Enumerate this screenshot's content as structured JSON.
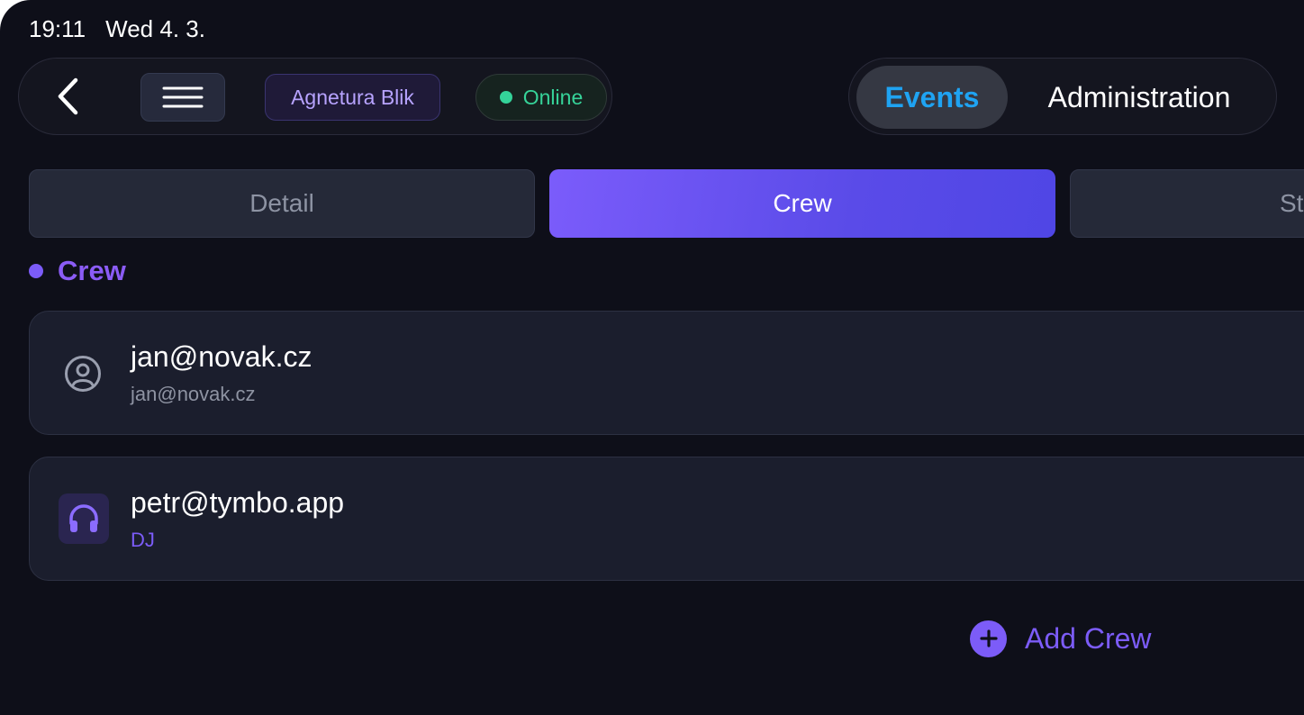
{
  "status_bar": {
    "time": "19:11",
    "date": "Wed 4. 3."
  },
  "toolbar": {
    "back_icon": "chevron-left-icon",
    "menu_icon": "hamburger-menu-icon",
    "agency": "Agnetura Blik",
    "status": "Online",
    "status_color": "#34d399"
  },
  "nav": {
    "events_label": "Events",
    "administration_label": "Administration",
    "active": "Events",
    "active_color": "#1fa3f2"
  },
  "tabs": [
    {
      "label": "Detail",
      "active": false
    },
    {
      "label": "Crew",
      "active": true
    },
    {
      "label": "St",
      "active": false
    }
  ],
  "section": {
    "title": "Crew",
    "accent_color": "#7c5cf8"
  },
  "crew": [
    {
      "name": "jan@novak.cz",
      "subtitle": "jan@novak.cz",
      "icon": "user-circle-icon"
    },
    {
      "name": "petr@tymbo.app",
      "subtitle": "DJ",
      "icon": "headphones-icon"
    }
  ],
  "add_crew": {
    "label": "Add Crew",
    "icon": "plus-circle-icon"
  }
}
